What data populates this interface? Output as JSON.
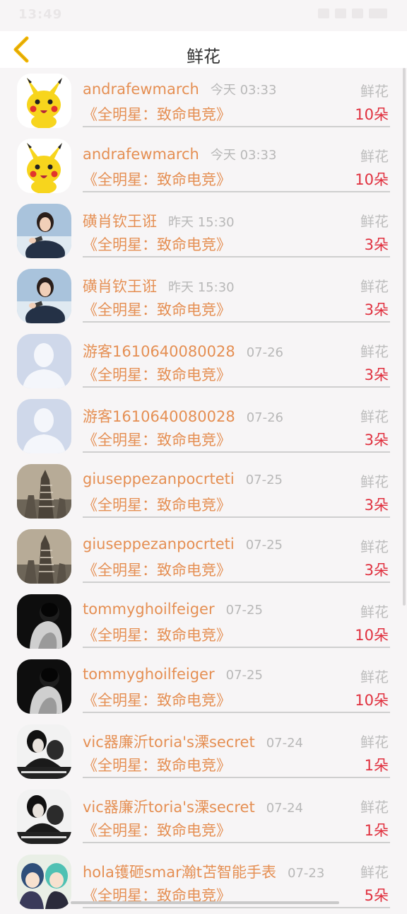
{
  "status": {
    "time": "13:49"
  },
  "header": {
    "title": "鲜花"
  },
  "rows": [
    {
      "name": "andrafewmarch",
      "time": "今天 03:33",
      "book": "《全明星：致命电竞》",
      "flower": "鲜花",
      "count": "10朵",
      "avatar": "pikachu"
    },
    {
      "name": "andrafewmarch",
      "time": "今天 03:33",
      "book": "《全明星：致命电竞》",
      "flower": "鲜花",
      "count": "10朵",
      "avatar": "pikachu"
    },
    {
      "name": "磺肖钦王诳",
      "time": "昨天 15:30",
      "book": "《全明星：致命电竞》",
      "flower": "鲜花",
      "count": "3朵",
      "avatar": "girl"
    },
    {
      "name": "磺肖钦王诳",
      "time": "昨天 15:30",
      "book": "《全明星：致命电竞》",
      "flower": "鲜花",
      "count": "3朵",
      "avatar": "girl"
    },
    {
      "name": "游客1610640080028",
      "time": "07-26",
      "book": "《全明星：致命电竞》",
      "flower": "鲜花",
      "count": "3朵",
      "avatar": "default"
    },
    {
      "name": "游客1610640080028",
      "time": "07-26",
      "book": "《全明星：致命电竞》",
      "flower": "鲜花",
      "count": "3朵",
      "avatar": "default"
    },
    {
      "name": "giuseppezanpocrteti",
      "time": "07-25",
      "book": "《全明星：致命电竞》",
      "flower": "鲜花",
      "count": "3朵",
      "avatar": "tower"
    },
    {
      "name": "giuseppezanpocrteti",
      "time": "07-25",
      "book": "《全明星：致命电竞》",
      "flower": "鲜花",
      "count": "3朵",
      "avatar": "tower"
    },
    {
      "name": "tommyghoilfeiger",
      "time": "07-25",
      "book": "《全明星：致命电竞》",
      "flower": "鲜花",
      "count": "10朵",
      "avatar": "dark"
    },
    {
      "name": "tommyghoilfeiger",
      "time": "07-25",
      "book": "《全明星：致命电竞》",
      "flower": "鲜花",
      "count": "10朵",
      "avatar": "dark"
    },
    {
      "name": "vic器廉沂toria's溧secret",
      "time": "07-24",
      "book": "《全明星：致命电竞》",
      "flower": "鲜花",
      "count": "1朵",
      "avatar": "couple"
    },
    {
      "name": "vic器廉沂toria's溧secret",
      "time": "07-24",
      "book": "《全明星：致命电竞》",
      "flower": "鲜花",
      "count": "1朵",
      "avatar": "couple"
    },
    {
      "name": "hola镬砸smar瀚t苫智能手表",
      "time": "07-23",
      "book": "《全明星：致命电竞》",
      "flower": "鲜花",
      "count": "5朵",
      "avatar": "anime"
    }
  ]
}
